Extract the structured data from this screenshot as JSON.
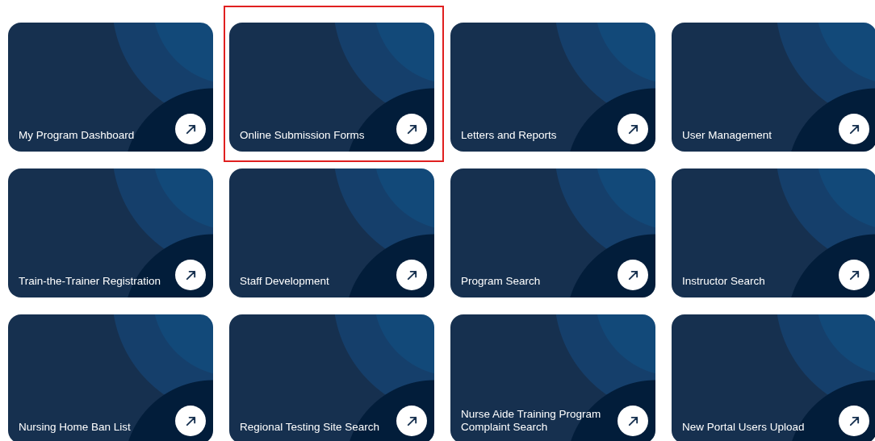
{
  "tiles": [
    {
      "label": "My Program Dashboard",
      "highlighted": false
    },
    {
      "label": "Online Submission Forms",
      "highlighted": true
    },
    {
      "label": "Letters and Reports",
      "highlighted": false
    },
    {
      "label": "User Management",
      "highlighted": false
    },
    {
      "label": "Train-the-Trainer Registration",
      "highlighted": false
    },
    {
      "label": "Staff Development",
      "highlighted": false
    },
    {
      "label": "Program Search",
      "highlighted": false
    },
    {
      "label": "Instructor Search",
      "highlighted": false
    },
    {
      "label": "Nursing Home Ban List",
      "highlighted": false
    },
    {
      "label": "Regional Testing Site Search",
      "highlighted": false
    },
    {
      "label": "Nurse Aide Training Program Complaint Search",
      "highlighted": false
    },
    {
      "label": "New Portal Users Upload",
      "highlighted": false
    }
  ]
}
